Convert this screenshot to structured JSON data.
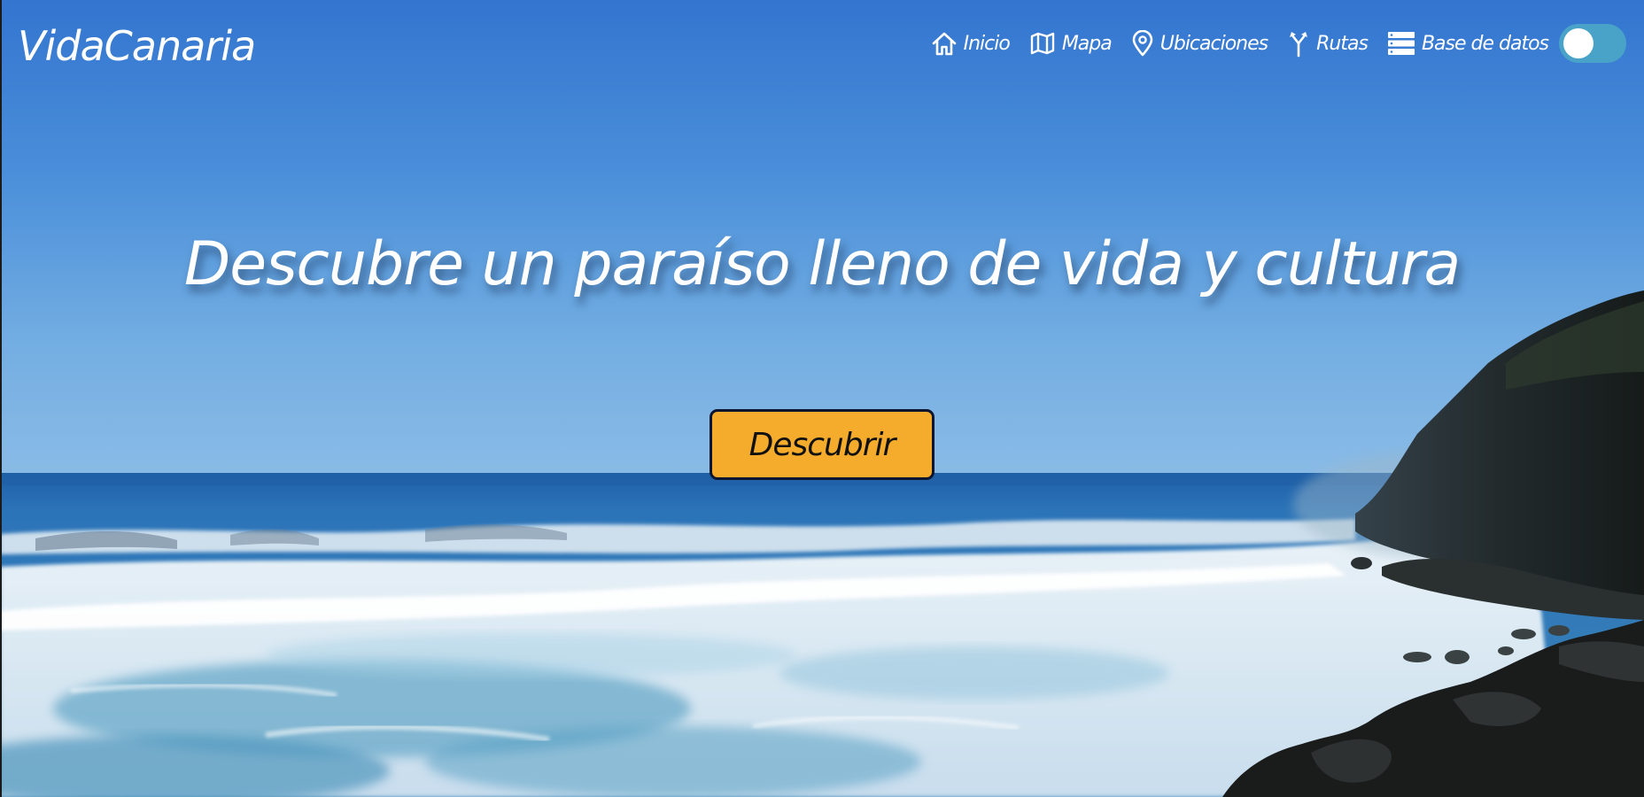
{
  "brand": "VidaCanaria",
  "nav": {
    "items": [
      {
        "label": "Inicio",
        "icon": "home-icon"
      },
      {
        "label": "Mapa",
        "icon": "map-icon"
      },
      {
        "label": "Ubicaciones",
        "icon": "location-pin-icon"
      },
      {
        "label": "Rutas",
        "icon": "route-fork-icon"
      },
      {
        "label": "Base de datos",
        "icon": "database-icon"
      }
    ],
    "theme_toggle": {
      "state": "off"
    }
  },
  "hero": {
    "title": "Descubre un paraíso lleno de vida y cultura",
    "cta_label": "Descubrir",
    "background": "ocean coastline with waves and dark volcanic cliffs"
  },
  "colors": {
    "sky": "#3a7fd0",
    "cta": "#f5ab2c",
    "cta_border": "#0c1530",
    "toggle": "#49a3c9",
    "text": "#ffffff"
  }
}
